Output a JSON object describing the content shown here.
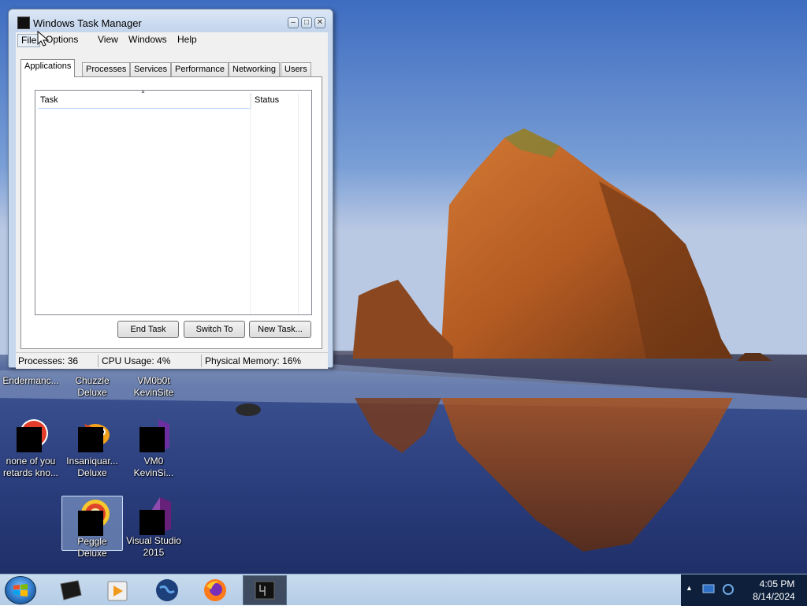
{
  "window": {
    "title": "Windows Task Manager",
    "menu": [
      "File",
      "Options",
      "View",
      "Windows",
      "Help"
    ],
    "tabs": [
      "Applications",
      "Processes",
      "Services",
      "Performance",
      "Networking",
      "Users"
    ],
    "active_tab": "Applications",
    "columns": [
      "Task",
      "Status"
    ],
    "buttons": {
      "end_task": "End Task",
      "switch_to": "Switch To",
      "new_task": "New Task..."
    },
    "status": {
      "processes": "Processes: 36",
      "cpu": "CPU Usage: 4%",
      "memory": "Physical Memory: 16%"
    }
  },
  "desktop_icons": [
    {
      "label": "Endermanc..."
    },
    {
      "label": "Chuzzle Deluxe"
    },
    {
      "label": "VM0b0t KevinSite"
    },
    {
      "label": "none of you retards kno..."
    },
    {
      "label": "Insaniquar... Deluxe"
    },
    {
      "label": "VM0 KevinSi..."
    },
    {
      "label": "Peggle Deluxe"
    },
    {
      "label": "Visual Studio 2015"
    }
  ],
  "taskbar": {
    "pinned": [
      "terminal-icon",
      "media-player-icon",
      "globe-icon",
      "firefox-icon",
      "task-manager-icon"
    ],
    "clock_time": "4:05 PM",
    "clock_date": "8/14/2024"
  },
  "colors": {
    "sky": "#4f7cc9",
    "sea": "#2a3f7a",
    "rock": "#b8612a",
    "taskbar": "#c8dbee"
  }
}
